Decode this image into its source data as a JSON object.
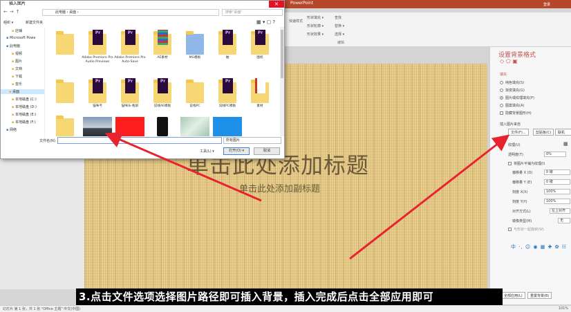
{
  "ppt": {
    "title": "PowerPoint",
    "login": "登录",
    "ribbon": {
      "items": [
        "形状填充 ▾",
        "形状轮廓 ▾",
        "形状效果 ▾",
        "查找",
        "替换 ▾",
        "选择 ▾"
      ],
      "group_label": "编辑",
      "left_label": "快速样式"
    },
    "slide": {
      "title": "单击此处添加标题",
      "subtitle": "单击此处添加副标题"
    },
    "format_pane": {
      "title": "设置背景格式",
      "section": "填充",
      "fill_options": [
        "纯色填充(S)",
        "渐变填充(G)",
        "图片或纹理填充(P)",
        "图案填充(A)",
        "隐藏背景图形(H)"
      ],
      "selected_fill": 2,
      "insert_from": "插入图片来自",
      "buttons": [
        "文件(F)...",
        "剪贴板(C)",
        "联机(E)..."
      ],
      "texture_label": "纹理(U)",
      "transparency_label": "透明度(T)",
      "transparency_value": "0%",
      "tile_label": "将图片平铺为纹理(I)",
      "fields": [
        {
          "label": "偏移量 X (O)",
          "value": "0 磅"
        },
        {
          "label": "偏移量 Y (E)",
          "value": "0 磅"
        },
        {
          "label": "刻度 X(X)",
          "value": "100%"
        },
        {
          "label": "刻度 Y(Y)",
          "value": "100%"
        },
        {
          "label": "对齐方式(L)",
          "value": "左上对齐"
        },
        {
          "label": "镜像类型(M)",
          "value": "无"
        }
      ],
      "rotate_label": "与形状一起旋转(W)",
      "apply_all": "全部应用(L)",
      "reset": "重置背景(B)"
    },
    "status": {
      "left": "幻灯片 第 1 张，共 1 张    \"Office 主题\"    中文(中国)",
      "zoom": "101%"
    }
  },
  "caption": "3.点击文件选项选择图片路径即可插入背景，插入完成后点击全部应用即可",
  "dialog": {
    "title": "插入图片",
    "address": "此电脑  ›  桌面  ›",
    "search_placeholder": "搜索\"桌面\"",
    "organize": "组织 ▾",
    "new_folder": "新建文件夹",
    "tree": [
      {
        "label": "店铺",
        "indent": 1
      },
      {
        "label": "Microsoft Powe",
        "indent": 0
      },
      {
        "label": "此电脑",
        "indent": 0
      },
      {
        "label": "视频",
        "indent": 1
      },
      {
        "label": "图片",
        "indent": 1
      },
      {
        "label": "文档",
        "indent": 1
      },
      {
        "label": "下载",
        "indent": 1
      },
      {
        "label": "音乐",
        "indent": 1
      },
      {
        "label": "桌面",
        "indent": 1,
        "selected": true
      },
      {
        "label": "本地磁盘 (C:)",
        "indent": 1
      },
      {
        "label": "本地磁盘 (D:)",
        "indent": 1
      },
      {
        "label": "本地磁盘 (E:)",
        "indent": 1
      },
      {
        "label": "本地磁盘 (F:)",
        "indent": 1
      },
      {
        "label": "网络",
        "indent": 0
      }
    ],
    "files": [
      {
        "label": "",
        "kind": "folder"
      },
      {
        "label": "Adobe Premiere Pro Audio Previews",
        "kind": "folder-pr"
      },
      {
        "label": "Adobe Premiere Pro Auto-Save",
        "kind": "folder-pr"
      },
      {
        "label": "AE素材",
        "kind": "folder-strip"
      },
      {
        "label": "MG模板",
        "kind": "folder-blue"
      },
      {
        "label": "抽",
        "kind": "folder-pr"
      },
      {
        "label": "图标",
        "kind": "folder-pr"
      },
      {
        "label": "图纹工程文件",
        "kind": "folder"
      },
      {
        "label": "",
        "kind": "folder"
      },
      {
        "label": "猫咪弓",
        "kind": "folder-pr"
      },
      {
        "label": "猫咪乐-瓶屏",
        "kind": "folder-pr"
      },
      {
        "label": "说线AE模板",
        "kind": "folder-pr"
      },
      {
        "label": "说线PC",
        "kind": "folder"
      },
      {
        "label": "说线PC模板",
        "kind": "folder-pr"
      },
      {
        "label": "素材",
        "kind": "folder-red"
      },
      {
        "label": "完成数据",
        "kind": "folder"
      }
    ],
    "thumbs": [
      {
        "kind": "folder"
      },
      {
        "kind": "sky"
      },
      {
        "kind": "red"
      },
      {
        "kind": "phone"
      },
      {
        "kind": "marble"
      },
      {
        "kind": "blue"
      }
    ],
    "filename_label": "文件名(N):",
    "filename_value": "",
    "filetype": "所有图片",
    "tools": "工具(L) ▾",
    "open": "打开(O) ▾",
    "cancel": "取消"
  }
}
